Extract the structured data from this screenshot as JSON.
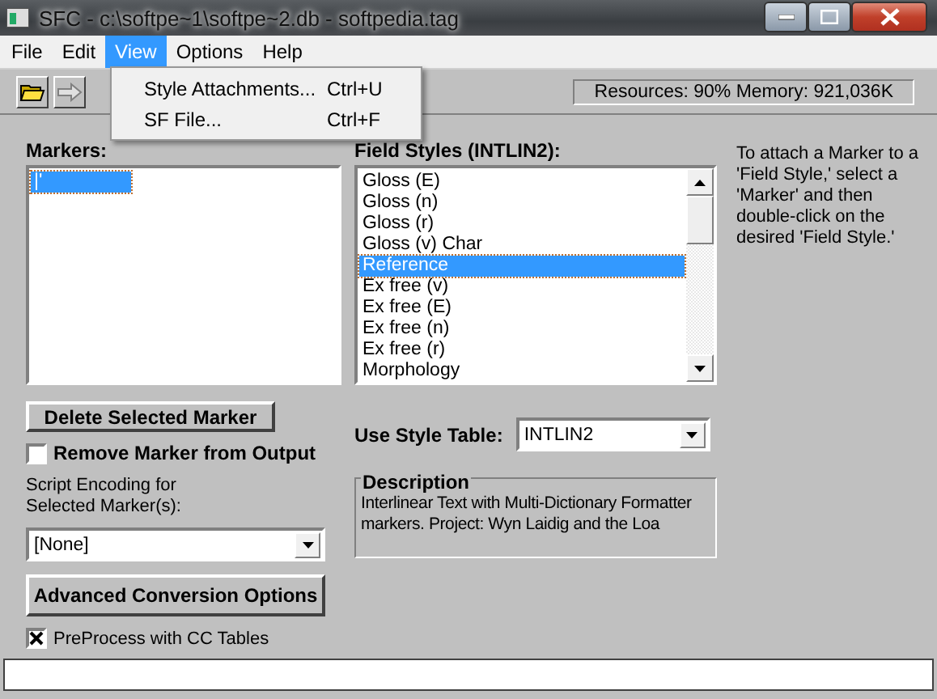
{
  "window": {
    "title": "SFC - c:\\softpe~1\\softpe~2.db - softpedia.tag"
  },
  "menu_bar": [
    {
      "label": "File",
      "selected": false
    },
    {
      "label": "Edit",
      "selected": false
    },
    {
      "label": "View",
      "selected": true
    },
    {
      "label": "Options",
      "selected": false
    },
    {
      "label": "Help",
      "selected": false
    }
  ],
  "open_menu": {
    "items": [
      {
        "label": "Style Attachments...",
        "shortcut": "Ctrl+U"
      },
      {
        "label": "SF File...",
        "shortcut": "Ctrl+F"
      }
    ]
  },
  "toolbar": {
    "status": "Resources: 90%  Memory: 921,036K"
  },
  "markers": {
    "label": "Markers:",
    "items": [
      {
        "label": "|'",
        "selected": true
      }
    ]
  },
  "field_styles": {
    "label": "Field Styles (INTLIN2):",
    "items": [
      {
        "label": "Gloss (E)",
        "selected": false
      },
      {
        "label": "Gloss (n)",
        "selected": false
      },
      {
        "label": "Gloss (r)",
        "selected": false
      },
      {
        "label": "Gloss (v) Char",
        "selected": false
      },
      {
        "label": "Reference",
        "selected": true
      },
      {
        "label": "Ex free (v)",
        "selected": false
      },
      {
        "label": "Ex free (E)",
        "selected": false
      },
      {
        "label": "Ex free (n)",
        "selected": false
      },
      {
        "label": "Ex free (r)",
        "selected": false
      },
      {
        "label": "Morphology",
        "selected": false
      }
    ]
  },
  "help_text": "To attach a Marker to a 'Field Style,' select a 'Marker' and then double-click on the desired 'Field Style.'",
  "delete_button": "Delete Selected Marker",
  "remove_marker": {
    "label": "Remove Marker from Output",
    "checked": false
  },
  "script_encoding": {
    "label": "Script Encoding for Selected Marker(s):",
    "value": "[None]"
  },
  "advanced_button": "Advanced Conversion Options",
  "preprocess": {
    "label": "PreProcess with CC Tables",
    "checked": true
  },
  "style_table": {
    "label": "Use Style Table:",
    "value": "INTLIN2"
  },
  "description": {
    "title": "Description",
    "text": "Interlinear Text with Multi-Dictionary Formatter markers. Project: Wyn Laidig and the Loa"
  }
}
